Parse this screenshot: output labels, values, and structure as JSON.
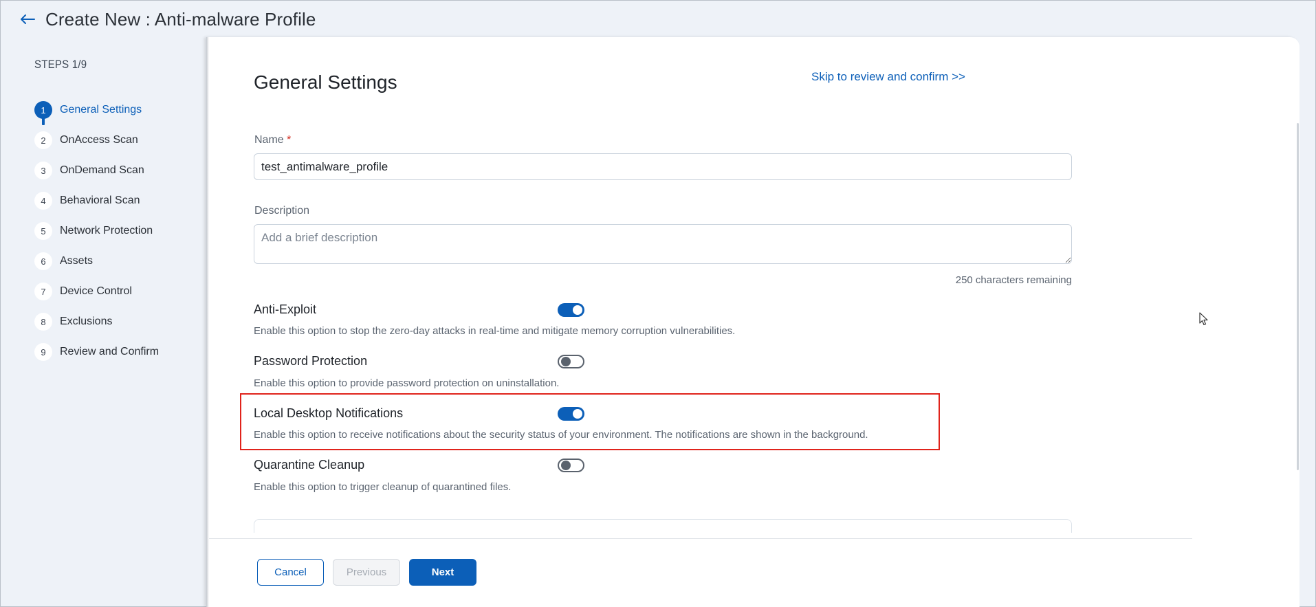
{
  "header": {
    "title": "Create New : Anti-malware Profile"
  },
  "sidebar": {
    "steps_label": "STEPS 1/9",
    "steps": [
      {
        "num": "1",
        "label": "General Settings",
        "active": true
      },
      {
        "num": "2",
        "label": "OnAccess Scan"
      },
      {
        "num": "3",
        "label": "OnDemand Scan"
      },
      {
        "num": "4",
        "label": "Behavioral Scan"
      },
      {
        "num": "5",
        "label": "Network Protection"
      },
      {
        "num": "6",
        "label": "Assets"
      },
      {
        "num": "7",
        "label": "Device Control"
      },
      {
        "num": "8",
        "label": "Exclusions"
      },
      {
        "num": "9",
        "label": "Review and Confirm"
      }
    ]
  },
  "main": {
    "section_title": "General Settings",
    "skip_link": "Skip to review and confirm >>",
    "name": {
      "label": "Name",
      "required_mark": "*",
      "value": "test_antimalware_profile"
    },
    "description": {
      "label": "Description",
      "placeholder": "Add a brief description",
      "chars_remaining": "250 characters remaining"
    },
    "options": [
      {
        "title": "Anti-Exploit",
        "desc": "Enable this option to stop the zero-day attacks in real-time and mitigate memory corruption vulnerabilities.",
        "enabled": true
      },
      {
        "title": "Password Protection",
        "desc": "Enable this option to provide password protection on uninstallation.",
        "enabled": false
      },
      {
        "title": "Local Desktop Notifications",
        "desc": "Enable this option to receive notifications about the security status of your environment. The notifications are shown in the background.",
        "enabled": true
      },
      {
        "title": "Quarantine Cleanup",
        "desc": "Enable this option to trigger cleanup of quarantined files.",
        "enabled": false
      }
    ]
  },
  "footer": {
    "cancel_label": "Cancel",
    "previous_label": "Previous",
    "next_label": "Next"
  },
  "colors": {
    "accent": "#0c5fb8",
    "highlight": "#e0231b"
  },
  "icons": {
    "back": "arrow-left-icon",
    "cursor": "mouse-pointer-icon"
  }
}
